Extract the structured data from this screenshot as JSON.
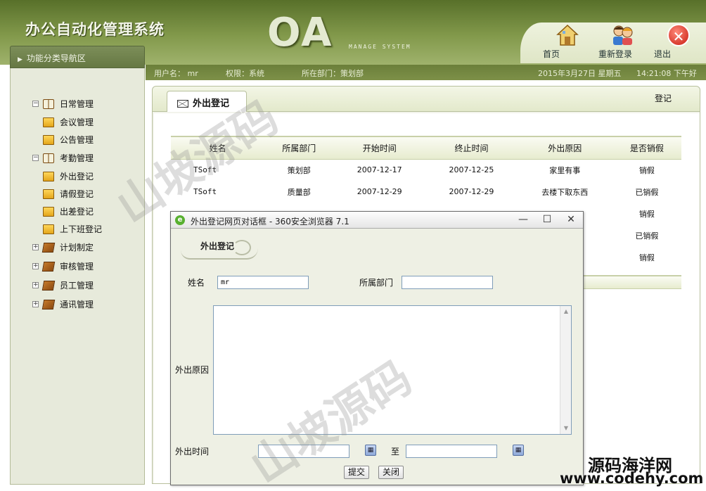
{
  "header": {
    "system_title": "办公自动化管理系统",
    "logo": "OA",
    "logo_sub": "MANAGE SYSTEM",
    "buttons": [
      {
        "label": "首页",
        "icon": "house-icon"
      },
      {
        "label": "重新登录",
        "icon": "users-icon"
      },
      {
        "label": "退出",
        "icon": "exit-icon"
      }
    ]
  },
  "infobar": {
    "user": "用户名： mr",
    "role": "权限：系统",
    "dept": "所在部门：策划部",
    "date": "2015年3月27日 星期五",
    "time": "14:21:08 下午好"
  },
  "nav": {
    "header": "功能分类导航区",
    "items": [
      {
        "label": "日常管理",
        "type": "group-open",
        "toggle": "⊟"
      },
      {
        "label": "会议管理",
        "type": "leaf"
      },
      {
        "label": "公告管理",
        "type": "leaf"
      },
      {
        "label": "考勤管理",
        "type": "group-open",
        "toggle": "⊟"
      },
      {
        "label": "外出登记",
        "type": "leaf"
      },
      {
        "label": "请假登记",
        "type": "leaf"
      },
      {
        "label": "出差登记",
        "type": "leaf"
      },
      {
        "label": "上下班登记",
        "type": "leaf"
      },
      {
        "label": "计划制定",
        "type": "group-closed",
        "toggle": "⊞"
      },
      {
        "label": "审核管理",
        "type": "group-closed",
        "toggle": "⊞"
      },
      {
        "label": "员工管理",
        "type": "group-closed",
        "toggle": "⊞"
      },
      {
        "label": "通讯管理",
        "type": "group-closed",
        "toggle": "⊞"
      }
    ]
  },
  "main": {
    "tab": "外出登记",
    "register_link": "登记",
    "columns": [
      "姓名",
      "所属部门",
      "开始时间",
      "终止时间",
      "外出原因",
      "是否销假"
    ],
    "rows": [
      [
        "TSoft",
        "策划部",
        "2007-12-17",
        "2007-12-25",
        "家里有事",
        "销假"
      ],
      [
        "TSoft",
        "质量部",
        "2007-12-29",
        "2007-12-29",
        "去楼下取东西",
        "已销假"
      ],
      [
        "",
        "",
        "",
        "",
        "",
        "销假"
      ],
      [
        "",
        "",
        "",
        "",
        "",
        "已销假"
      ],
      [
        "",
        "",
        "",
        "",
        "",
        "销假"
      ]
    ]
  },
  "dialog": {
    "title": "外出登记网页对话框 - 360安全浏览器 7.1",
    "heading": "外出登记",
    "name_label": "姓名",
    "name_value": "mr",
    "dept_label": "所属部门",
    "dept_value": "",
    "reason_label": "外出原因",
    "time_label": "外出时间",
    "to_label": "至",
    "submit": "提交",
    "close": "关闭",
    "win_min": "—",
    "win_max": "☐",
    "win_close": "✕"
  },
  "watermarks": {
    "wm1": "山坡源码",
    "wm2": "山坡源码",
    "corner1": "源码海洋网",
    "corner2": "www.codehy.com"
  }
}
